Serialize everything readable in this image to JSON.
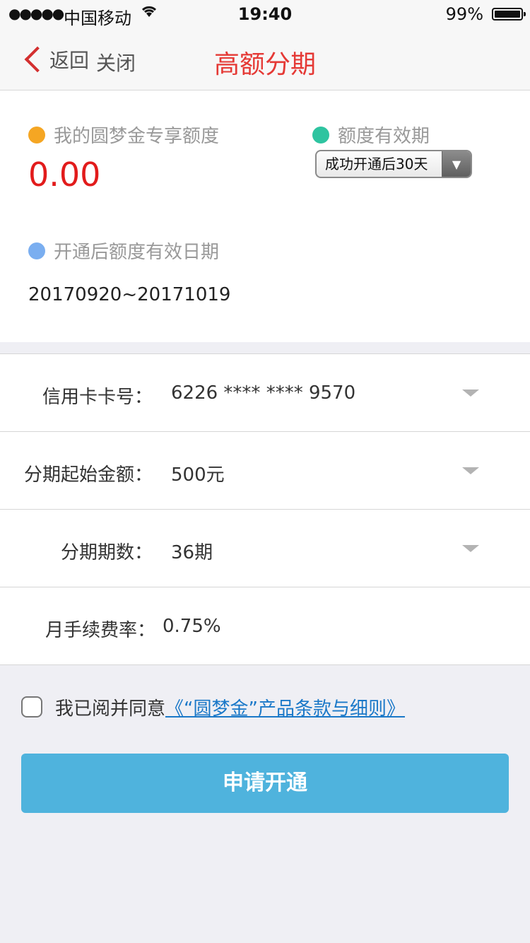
{
  "status_bar": {
    "signal": "●●●●●",
    "carrier": "中国移动",
    "time": "19:40",
    "battery_percent": "99%"
  },
  "nav": {
    "back_label": "返回",
    "close_label": "关闭",
    "title": "高额分期"
  },
  "quota": {
    "label": "我的圆梦金专享额度",
    "value": "0.00",
    "validity_label": "额度有效期",
    "validity_selected": "成功开通后30天",
    "date_label": "开通后额度有效日期",
    "date_range": "20170920~20171019"
  },
  "form": {
    "card_label": "信用卡卡号：",
    "card_value": "6226 **** **** 9570",
    "start_amount_label": "分期起始金额：",
    "start_amount_value": "500元",
    "periods_label": "分期期数：",
    "periods_value": "36期",
    "rate_label": "月手续费率：",
    "rate_value": "0.75%"
  },
  "agreement": {
    "text": "我已阅并同意",
    "link": "《“圆梦金”产品条款与细则》"
  },
  "apply_button": "申请开通",
  "colors": {
    "title_red": "#e53935",
    "quota_red": "#e21b1b",
    "dot_orange": "#f5a623",
    "dot_green": "#2ec4a0",
    "dot_blue": "#7aaef0",
    "button_blue": "#4fb3dd",
    "link_blue": "#1a78c8"
  }
}
